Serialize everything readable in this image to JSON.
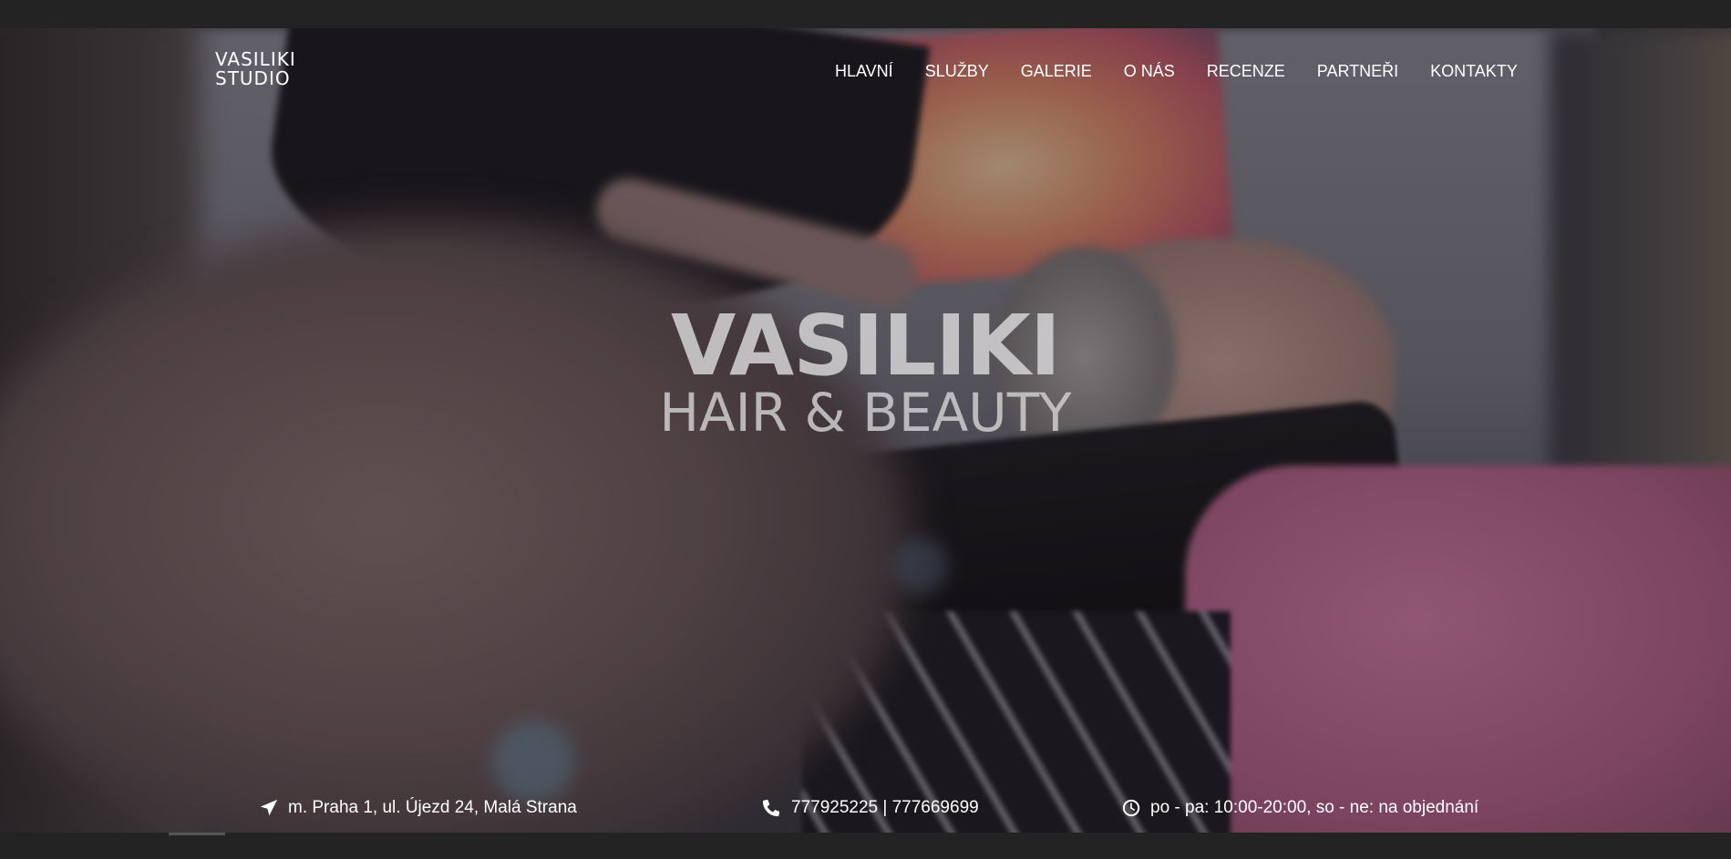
{
  "brand": {
    "line1": "VASILIKI",
    "line2": "STUDIO"
  },
  "nav": [
    {
      "label": "HLAVNÍ"
    },
    {
      "label": "SLUŽBY"
    },
    {
      "label": "GALERIE"
    },
    {
      "label": "O NÁS"
    },
    {
      "label": "RECENZE"
    },
    {
      "label": "PARTNEŘI"
    },
    {
      "label": "KONTAKTY"
    }
  ],
  "hero": {
    "title": "VASILIKI",
    "subtitle": "HAIR & BEAUTY"
  },
  "info": {
    "address": {
      "icon": "location-arrow-icon",
      "text": "m. Praha 1, ul. Újezd 24, Malá Strana"
    },
    "phone": {
      "icon": "phone-icon",
      "text": "777925225 | 777669699"
    },
    "hours": {
      "icon": "clock-icon",
      "text": "po - pa: 10:00-20:00, so - ne: na objednání"
    }
  }
}
